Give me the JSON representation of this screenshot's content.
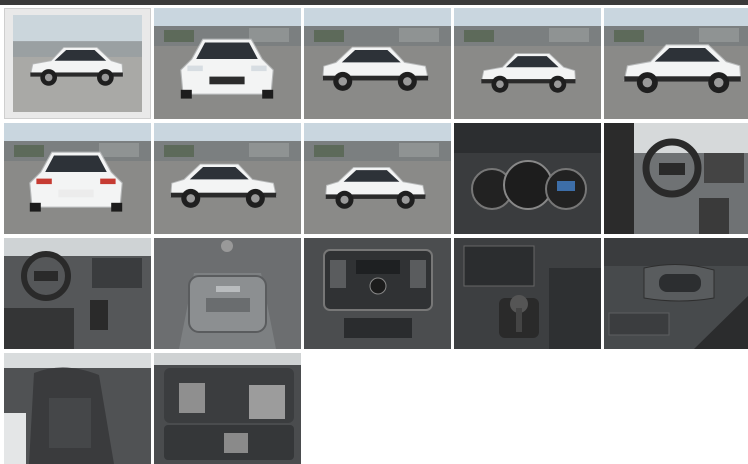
{
  "gallery": {
    "selected_index": 0,
    "thumbnails": [
      {
        "kind": "exterior",
        "view": "front-left",
        "bg": "sky",
        "selected": true
      },
      {
        "kind": "exterior",
        "view": "front"
      },
      {
        "kind": "exterior",
        "view": "front-right"
      },
      {
        "kind": "exterior",
        "view": "rear-right"
      },
      {
        "kind": "exterior",
        "view": "rear-right-close"
      },
      {
        "kind": "exterior",
        "view": "rear"
      },
      {
        "kind": "exterior",
        "view": "rear-left"
      },
      {
        "kind": "exterior",
        "view": "side"
      },
      {
        "kind": "interior",
        "view": "gauges"
      },
      {
        "kind": "interior",
        "view": "dashboard"
      },
      {
        "kind": "interior",
        "view": "steering"
      },
      {
        "kind": "interior",
        "view": "ceiling-light"
      },
      {
        "kind": "interior",
        "view": "console"
      },
      {
        "kind": "interior",
        "view": "gearshift"
      },
      {
        "kind": "interior",
        "view": "door-handle"
      },
      {
        "kind": "interior",
        "view": "front-seat"
      },
      {
        "kind": "interior",
        "view": "rear-seats"
      }
    ]
  },
  "colors": {
    "car_body": "#f3f4f4",
    "car_glass": "#2d3238",
    "asphalt": "#8a8a88",
    "sky": "#c9d6df",
    "interior_dark": "#3a3c3e",
    "tail_light": "#c63b32"
  }
}
